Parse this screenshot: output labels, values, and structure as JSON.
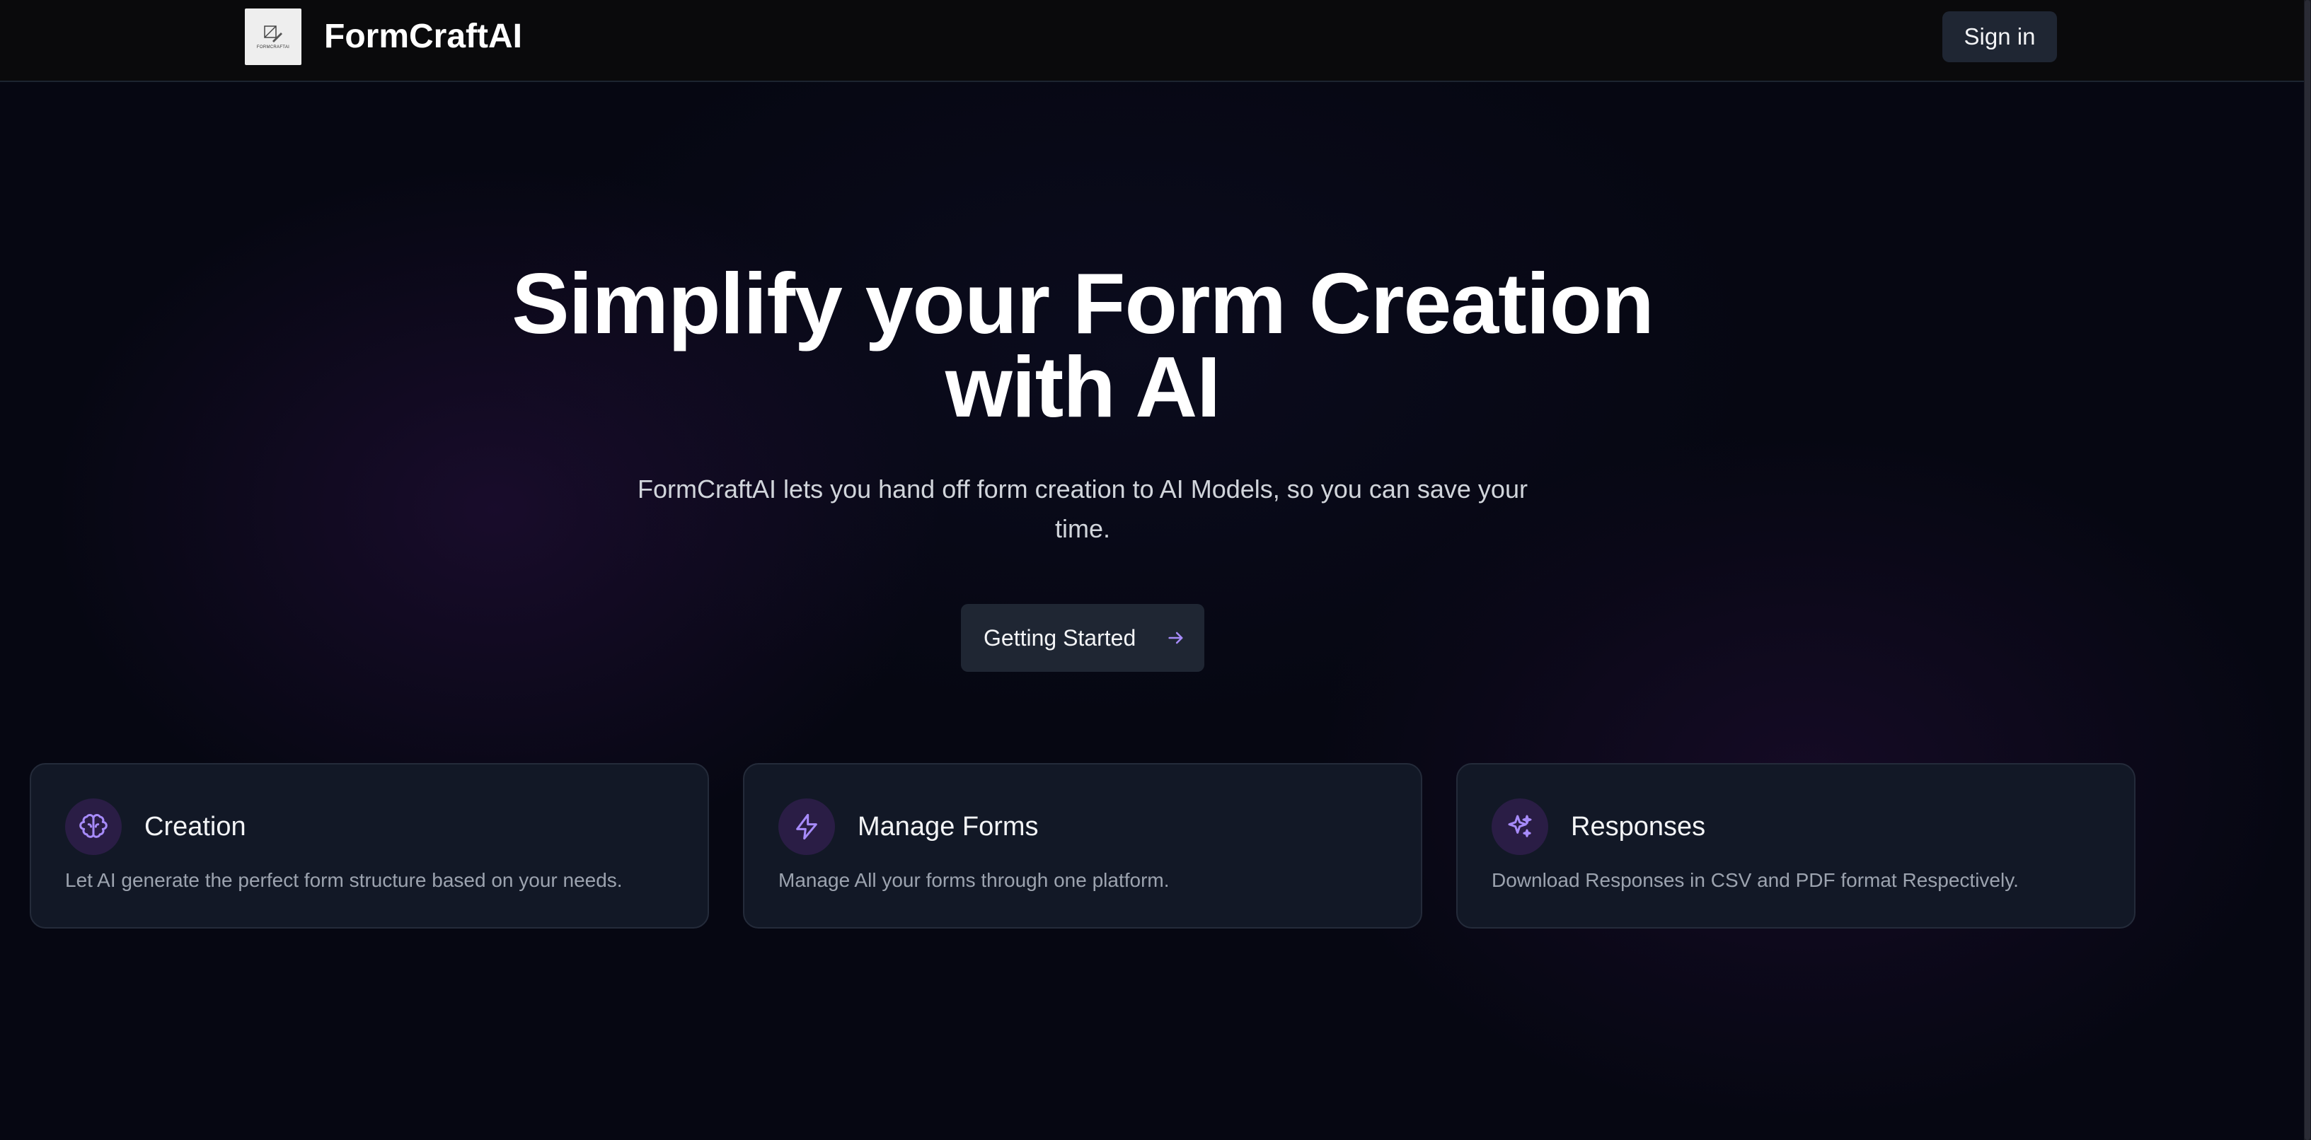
{
  "header": {
    "logo_caption": "FORMCRAFTAI",
    "brand": "FormCraftAI",
    "signin_label": "Sign in"
  },
  "hero": {
    "title_line1": "Simplify your Form Creation",
    "title_line2": "with AI",
    "subtitle_line1": "FormCraftAI lets you hand off form creation to AI Models, so you can save your",
    "subtitle_line2": "time.",
    "cta_label": "Getting Started",
    "cta_icon": "arrow-right-icon"
  },
  "features": [
    {
      "icon": "brain-icon",
      "title": "Creation",
      "description": "Let AI generate the perfect form structure based on your needs."
    },
    {
      "icon": "lightning-icon",
      "title": "Manage Forms",
      "description": "Manage All your forms through one platform."
    },
    {
      "icon": "sparkles-icon",
      "title": "Responses",
      "description": "Download Responses in CSV and PDF format Respectively."
    }
  ],
  "colors": {
    "accent": "#a78bfa",
    "background": "#060712",
    "card": "#121826",
    "button": "#1f2633"
  }
}
